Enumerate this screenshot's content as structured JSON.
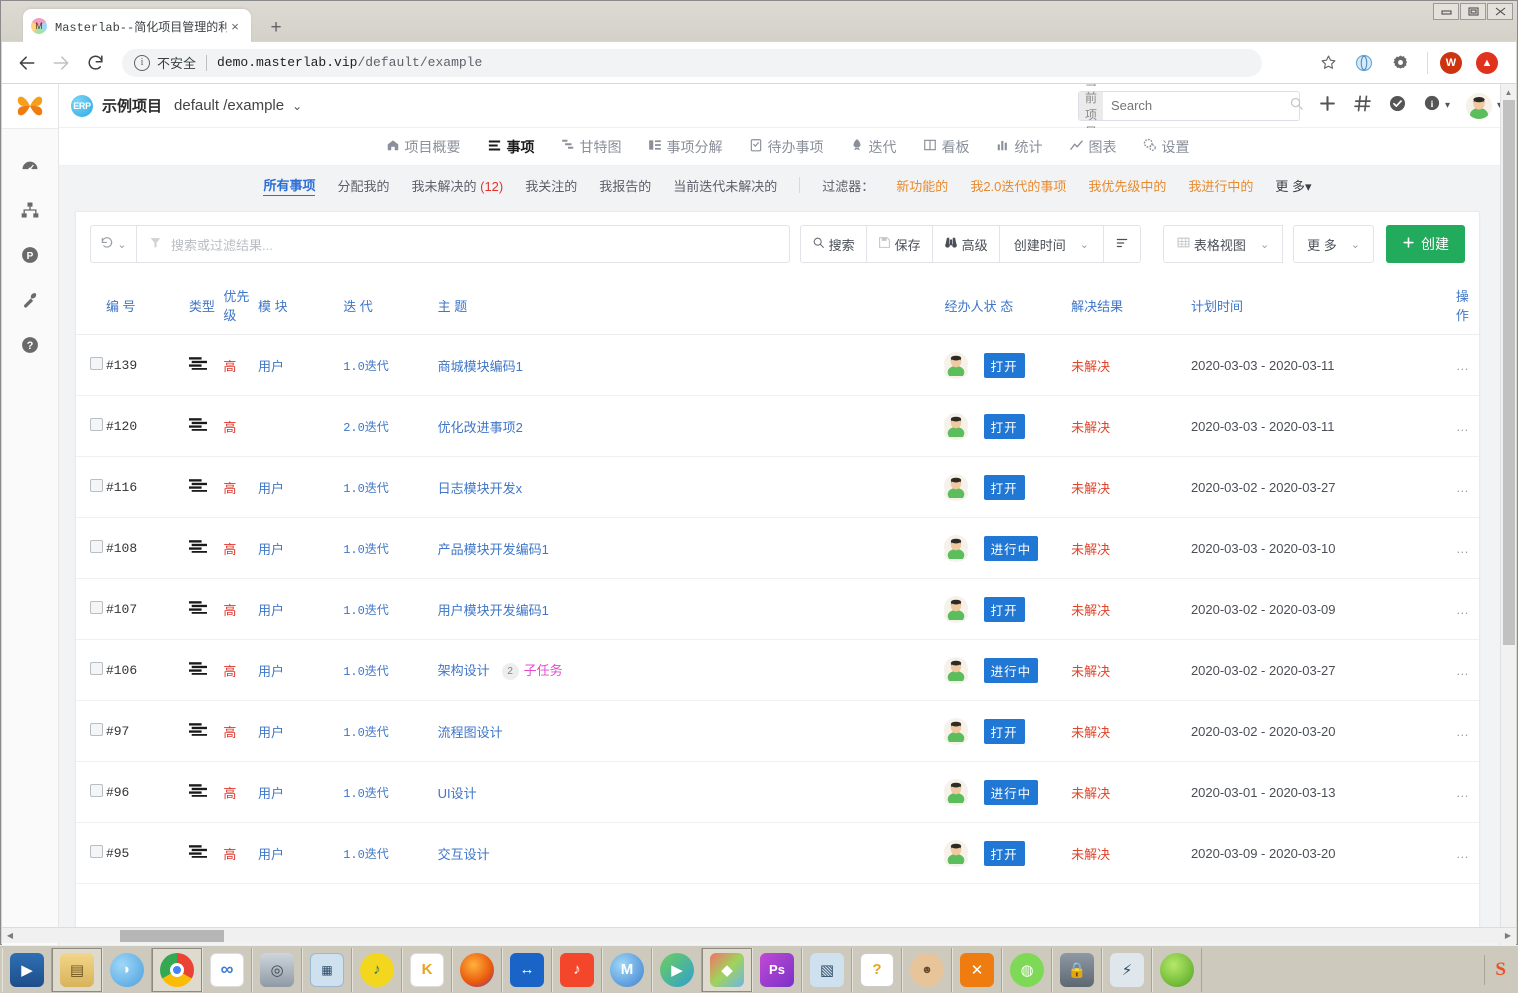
{
  "browser": {
    "tab": {
      "title": "Masterlab--简化项目管理的利器",
      "favicon": "masterlab-favicon",
      "close": "×"
    },
    "new_tab": "+",
    "nav": {
      "back": "←",
      "forward": "→",
      "reload": "⟳"
    },
    "omnibox": {
      "security_label": "不安全",
      "url_host": "demo.masterlab.vip",
      "url_path": "/default/example"
    },
    "right_icons": [
      "star-icon",
      "browser-extension-icon",
      "settings-gear-icon",
      "w-extension-icon",
      "up-extension-icon"
    ],
    "window_controls": [
      "minimize",
      "maximize",
      "close"
    ]
  },
  "rail": {
    "logo": "masterlab-butterfly-logo",
    "items": [
      {
        "name": "dashboard-icon"
      },
      {
        "name": "org-chart-icon"
      },
      {
        "name": "project-p-icon"
      },
      {
        "name": "wrench-icon"
      },
      {
        "name": "help-question-icon"
      }
    ]
  },
  "appheader": {
    "project_badge": "ERP",
    "project_name": "示例项目",
    "project_path": "default /example",
    "caret": "⌄",
    "search": {
      "scope": "当前项目",
      "placeholder": "Search",
      "value": ""
    },
    "icons": [
      "plus-icon",
      "hash-icon",
      "check-circle-icon",
      "info-circle-icon",
      "user-avatar"
    ]
  },
  "navtabs": [
    {
      "label": "项目概要",
      "icon": "home-icon",
      "active": false
    },
    {
      "label": "事项",
      "icon": "list-icon",
      "active": true
    },
    {
      "label": "甘特图",
      "icon": "gantt-icon",
      "active": false
    },
    {
      "label": "事项分解",
      "icon": "breakdown-icon",
      "active": false
    },
    {
      "label": "待办事项",
      "icon": "todo-icon",
      "active": false
    },
    {
      "label": "迭代",
      "icon": "rocket-icon",
      "active": false
    },
    {
      "label": "看板",
      "icon": "board-icon",
      "active": false
    },
    {
      "label": "统计",
      "icon": "bar-chart-icon",
      "active": false
    },
    {
      "label": "图表",
      "icon": "line-chart-icon",
      "active": false
    },
    {
      "label": "设置",
      "icon": "gear-icon",
      "active": false
    }
  ],
  "filterbar": {
    "links": [
      {
        "label": "所有事项",
        "active": true
      },
      {
        "label": "分配我的",
        "active": false
      },
      {
        "label": "我未解决的",
        "count": "(12)",
        "active": false
      },
      {
        "label": "我关注的",
        "active": false
      },
      {
        "label": "我报告的",
        "active": false
      },
      {
        "label": "当前迭代未解决的",
        "active": false
      }
    ],
    "filters_label": "过滤器：",
    "filters": [
      "新功能的",
      "我2.0迭代的事项",
      "我优先级中的",
      "我进行中的"
    ],
    "more": "更 多▾"
  },
  "toolbar": {
    "revert_icon": "revert-icon",
    "revert_caret": "⌄",
    "filter_icon": "funnel-icon",
    "search_placeholder": "搜索或过滤结果...",
    "search_value": "",
    "buttons": [
      {
        "label": "搜索",
        "icon": "search-icon"
      },
      {
        "label": "保存",
        "icon": "save-icon"
      },
      {
        "label": "高级",
        "icon": "binoculars-icon"
      },
      {
        "label": "创建时间",
        "icon": "",
        "caret": "⌄"
      }
    ],
    "sort_icon": "sort-icon",
    "view_button": {
      "label": "表格视图",
      "icon": "table-icon",
      "caret": "⌄"
    },
    "more_button": {
      "label": "更 多",
      "caret": "⌄"
    },
    "create_button": {
      "label": "创建",
      "icon": "plus-icon"
    }
  },
  "table": {
    "columns": [
      "编 号",
      "类型",
      "优先级",
      "模 块",
      "迭 代",
      "主 题",
      "经办人",
      "状 态",
      "解决结果",
      "计划时间",
      "操作"
    ],
    "rows": [
      {
        "id": "#139",
        "type": "list-type-icon",
        "priority": "高",
        "module": "用户",
        "iteration": "1.0迭代",
        "topic": "商城模块编码1",
        "subtask_count": "",
        "subtask_label": "",
        "assignee": "user-avatar",
        "status": "打开",
        "resolution": "未解决",
        "plan": "2020-03-03 - 2020-03-11",
        "action": "…"
      },
      {
        "id": "#120",
        "type": "list-type-icon",
        "priority": "高",
        "module": "",
        "iteration": "2.0迭代",
        "topic": "优化改进事项2",
        "subtask_count": "",
        "subtask_label": "",
        "assignee": "user-avatar",
        "status": "打开",
        "resolution": "未解决",
        "plan": "2020-03-03 - 2020-03-11",
        "action": "…"
      },
      {
        "id": "#116",
        "type": "list-type-icon",
        "priority": "高",
        "module": "用户",
        "iteration": "1.0迭代",
        "topic": "日志模块开发x",
        "subtask_count": "",
        "subtask_label": "",
        "assignee": "user-avatar",
        "status": "打开",
        "resolution": "未解决",
        "plan": "2020-03-02 - 2020-03-27",
        "action": "…"
      },
      {
        "id": "#108",
        "type": "list-type-icon",
        "priority": "高",
        "module": "用户",
        "iteration": "1.0迭代",
        "topic": "产品模块开发编码1",
        "subtask_count": "",
        "subtask_label": "",
        "assignee": "user-avatar",
        "status": "进行中",
        "resolution": "未解决",
        "plan": "2020-03-03 - 2020-03-10",
        "action": "…"
      },
      {
        "id": "#107",
        "type": "list-type-icon",
        "priority": "高",
        "module": "用户",
        "iteration": "1.0迭代",
        "topic": "用户模块开发编码1",
        "subtask_count": "",
        "subtask_label": "",
        "assignee": "user-avatar",
        "status": "打开",
        "resolution": "未解决",
        "plan": "2020-03-02 - 2020-03-09",
        "action": "…"
      },
      {
        "id": "#106",
        "type": "list-type-icon",
        "priority": "高",
        "module": "用户",
        "iteration": "1.0迭代",
        "topic": "架构设计",
        "subtask_count": "2",
        "subtask_label": "子任务",
        "assignee": "user-avatar",
        "status": "进行中",
        "resolution": "未解决",
        "plan": "2020-03-02 - 2020-03-27",
        "action": "…"
      },
      {
        "id": "#97",
        "type": "list-type-icon",
        "priority": "高",
        "module": "用户",
        "iteration": "1.0迭代",
        "topic": "流程图设计",
        "subtask_count": "",
        "subtask_label": "",
        "assignee": "user-avatar",
        "status": "打开",
        "resolution": "未解决",
        "plan": "2020-03-02 - 2020-03-20",
        "action": "…"
      },
      {
        "id": "#96",
        "type": "list-type-icon",
        "priority": "高",
        "module": "用户",
        "iteration": "1.0迭代",
        "topic": "UI设计",
        "subtask_count": "",
        "subtask_label": "",
        "assignee": "user-avatar",
        "status": "进行中",
        "resolution": "未解决",
        "plan": "2020-03-01 - 2020-03-13",
        "action": "…"
      },
      {
        "id": "#95",
        "type": "list-type-icon",
        "priority": "高",
        "module": "用户",
        "iteration": "1.0迭代",
        "topic": "交互设计",
        "subtask_count": "",
        "subtask_label": "",
        "assignee": "user-avatar",
        "status": "打开",
        "resolution": "未解决",
        "plan": "2020-03-09 - 2020-03-20",
        "action": "…"
      }
    ]
  },
  "taskbar": {
    "items": [
      "media-player-icon",
      "file-explorer-icon",
      "cloud-browser-icon",
      "chrome-icon",
      "ant-cloud-icon",
      "camera-icon",
      "calculator-icon",
      "qq-music-icon",
      "kugou-icon",
      "firefox-icon",
      "teamviewer-icon",
      "douyin-icon",
      "mumu-icon",
      "potplayer-icon",
      "wps-icon",
      "photoshop-icon",
      "virtualbox-icon",
      "help-doc-icon",
      "face-photo-icon",
      "masterlab-icon",
      "wechat-icon",
      "lock-icon",
      "network-icon",
      "leaf-icon"
    ],
    "tray": [
      "sogou-input-icon"
    ]
  },
  "colors": {
    "accent_blue": "#3f76c8",
    "status_blue": "#2077d4",
    "danger_red": "#e0352b",
    "create_green": "#22ab5c",
    "filter_orange": "#e88b2e",
    "subtask_pink": "#e64bd0",
    "logo_orange": "#f07d1a"
  }
}
